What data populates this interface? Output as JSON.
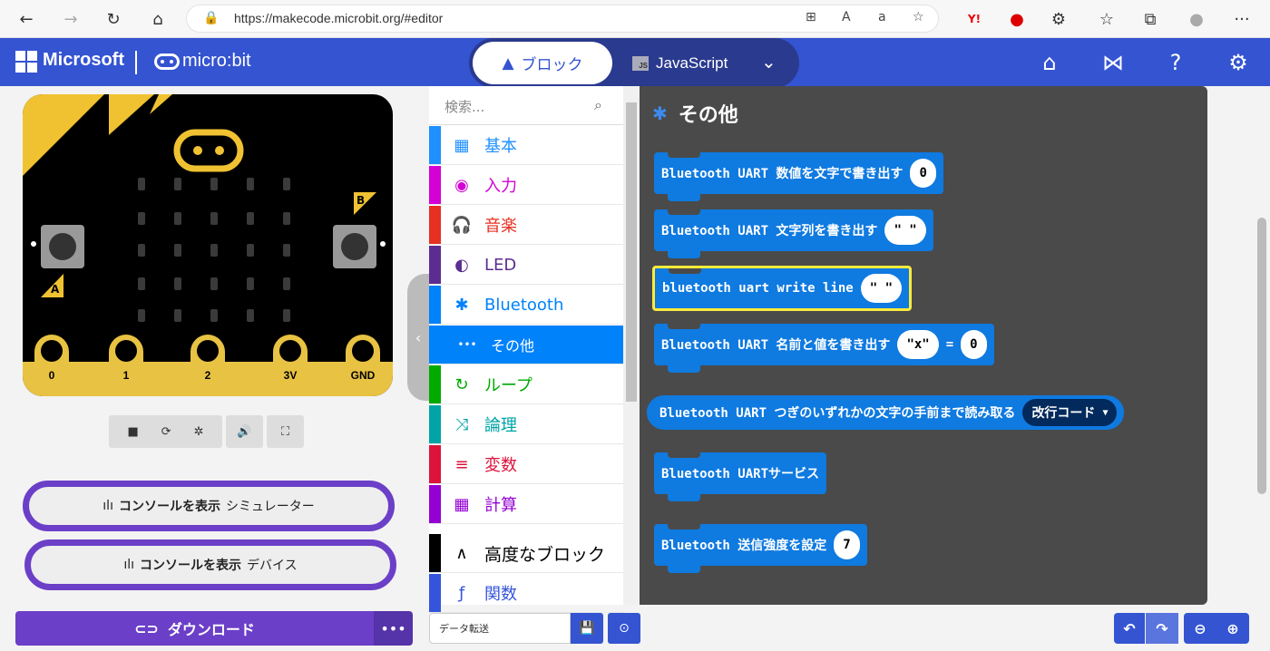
{
  "browser": {
    "url": "https://makecode.microbit.org/#editor",
    "back": "←",
    "forward": "→",
    "refresh": "↻",
    "home": "⌂",
    "menu": "···"
  },
  "header": {
    "brand": "Microsoft",
    "product": "micro:bit",
    "tab_blocks": "ブロック",
    "tab_js": "JavaScript",
    "js_badge": "JS"
  },
  "simulator": {
    "button_a": "A",
    "button_b": "B",
    "pins": [
      "0",
      "1",
      "2",
      "3V",
      "GND"
    ],
    "console_sim_bold": "コンソールを表示",
    "console_sim_rest": "シミュレーター",
    "console_dev_bold": "コンソールを表示",
    "console_dev_rest": "デバイス",
    "download": "ダウンロード",
    "more": "•••"
  },
  "toolbox": {
    "search_placeholder": "検索...",
    "categories": [
      {
        "label": "基本",
        "color": "#1e90ff",
        "icon": "▦"
      },
      {
        "label": "入力",
        "color": "#d400d4",
        "icon": "◉"
      },
      {
        "label": "音楽",
        "color": "#e63022",
        "icon": "🎧"
      },
      {
        "label": "LED",
        "color": "#5c2d91",
        "icon": "◐"
      },
      {
        "label": "Bluetooth",
        "color": "#0082fb",
        "icon": "✱"
      },
      {
        "label": "その他",
        "color": "#0082fb",
        "icon": "•••"
      },
      {
        "label": "ループ",
        "color": "#00aa00",
        "icon": "↻"
      },
      {
        "label": "論理",
        "color": "#00a4a6",
        "icon": "⤨"
      },
      {
        "label": "変数",
        "color": "#dc143c",
        "icon": "≡"
      },
      {
        "label": "計算",
        "color": "#9400d3",
        "icon": "▦"
      },
      {
        "label": "高度なブロック",
        "color": "#000000",
        "icon": "∧"
      },
      {
        "label": "関数",
        "color": "#3455db",
        "icon": "ƒ"
      }
    ]
  },
  "workspace": {
    "title": "その他",
    "blocks": {
      "b1_text": "Bluetooth UART 数値を文字で書き出す",
      "b1_value": "0",
      "b2_text": "Bluetooth UART 文字列を書き出す",
      "b2_value": "\" \"",
      "b3_text": "bluetooth uart write line",
      "b3_value": "\" \"",
      "b4_text": "Bluetooth UART 名前と値を書き出す",
      "b4_name": "\"x\"",
      "b4_eq": "=",
      "b4_value": "0",
      "b5_text": "Bluetooth UART つぎのいずれかの文字の手前まで読み取る",
      "b5_dropdown": "改行コード",
      "b6_text": "Bluetooth UARTサービス",
      "b7_text": "Bluetooth 送信強度を設定",
      "b7_value": "7"
    }
  },
  "bottom": {
    "project_name": "データ転送"
  }
}
